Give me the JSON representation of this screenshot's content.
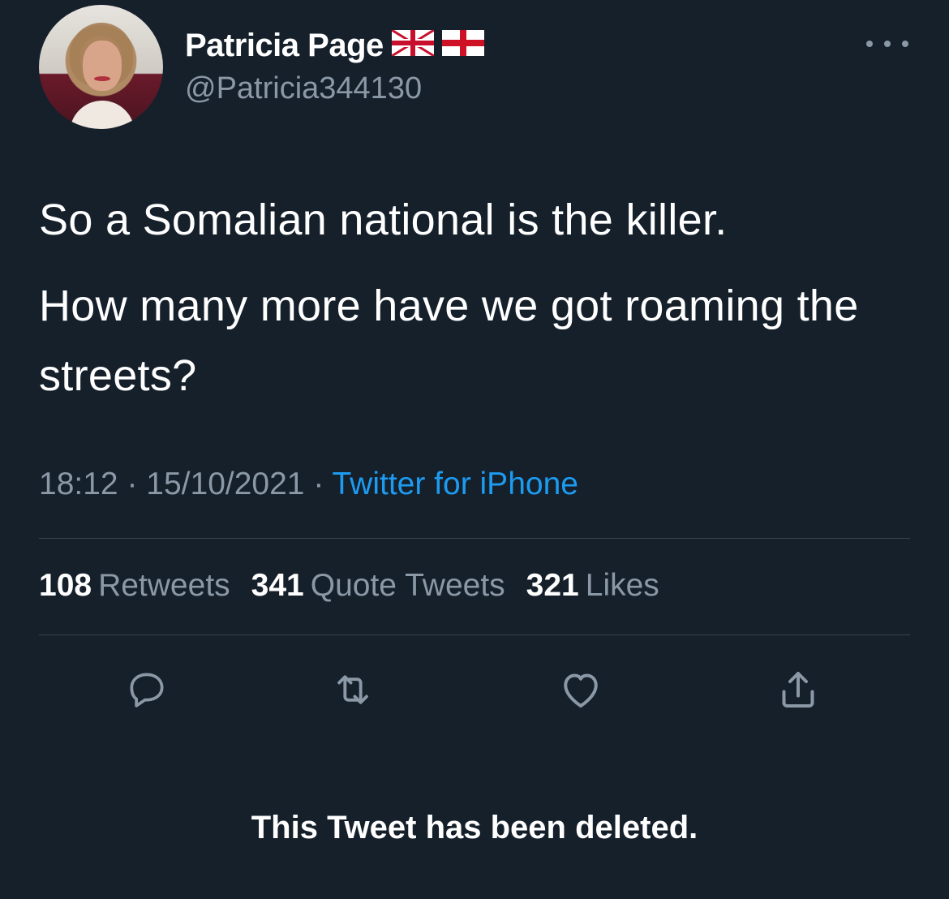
{
  "author": {
    "display_name": "Patricia Page",
    "flags": [
      "uk-flag-icon",
      "england-flag-icon"
    ],
    "handle": "@Patricia344130"
  },
  "tweet": {
    "paragraph_1": "So a Somalian national is the killer.",
    "paragraph_2": "How many more have we got roaming the streets?",
    "time": "18:12",
    "date": "15/10/2021",
    "separator": "·",
    "source": "Twitter for iPhone"
  },
  "stats": {
    "retweets_count": "108",
    "retweets_label": "Retweets",
    "quotes_count": "341",
    "quotes_label": "Quote Tweets",
    "likes_count": "321",
    "likes_label": "Likes"
  },
  "actions": [
    "reply-icon",
    "retweet-icon",
    "like-icon",
    "share-icon"
  ],
  "notice": "This Tweet has been deleted.",
  "colors": {
    "background": "#15202b",
    "text": "#ffffff",
    "secondary": "#8b98a5",
    "link": "#1d9bf0",
    "divider": "#38444d"
  }
}
